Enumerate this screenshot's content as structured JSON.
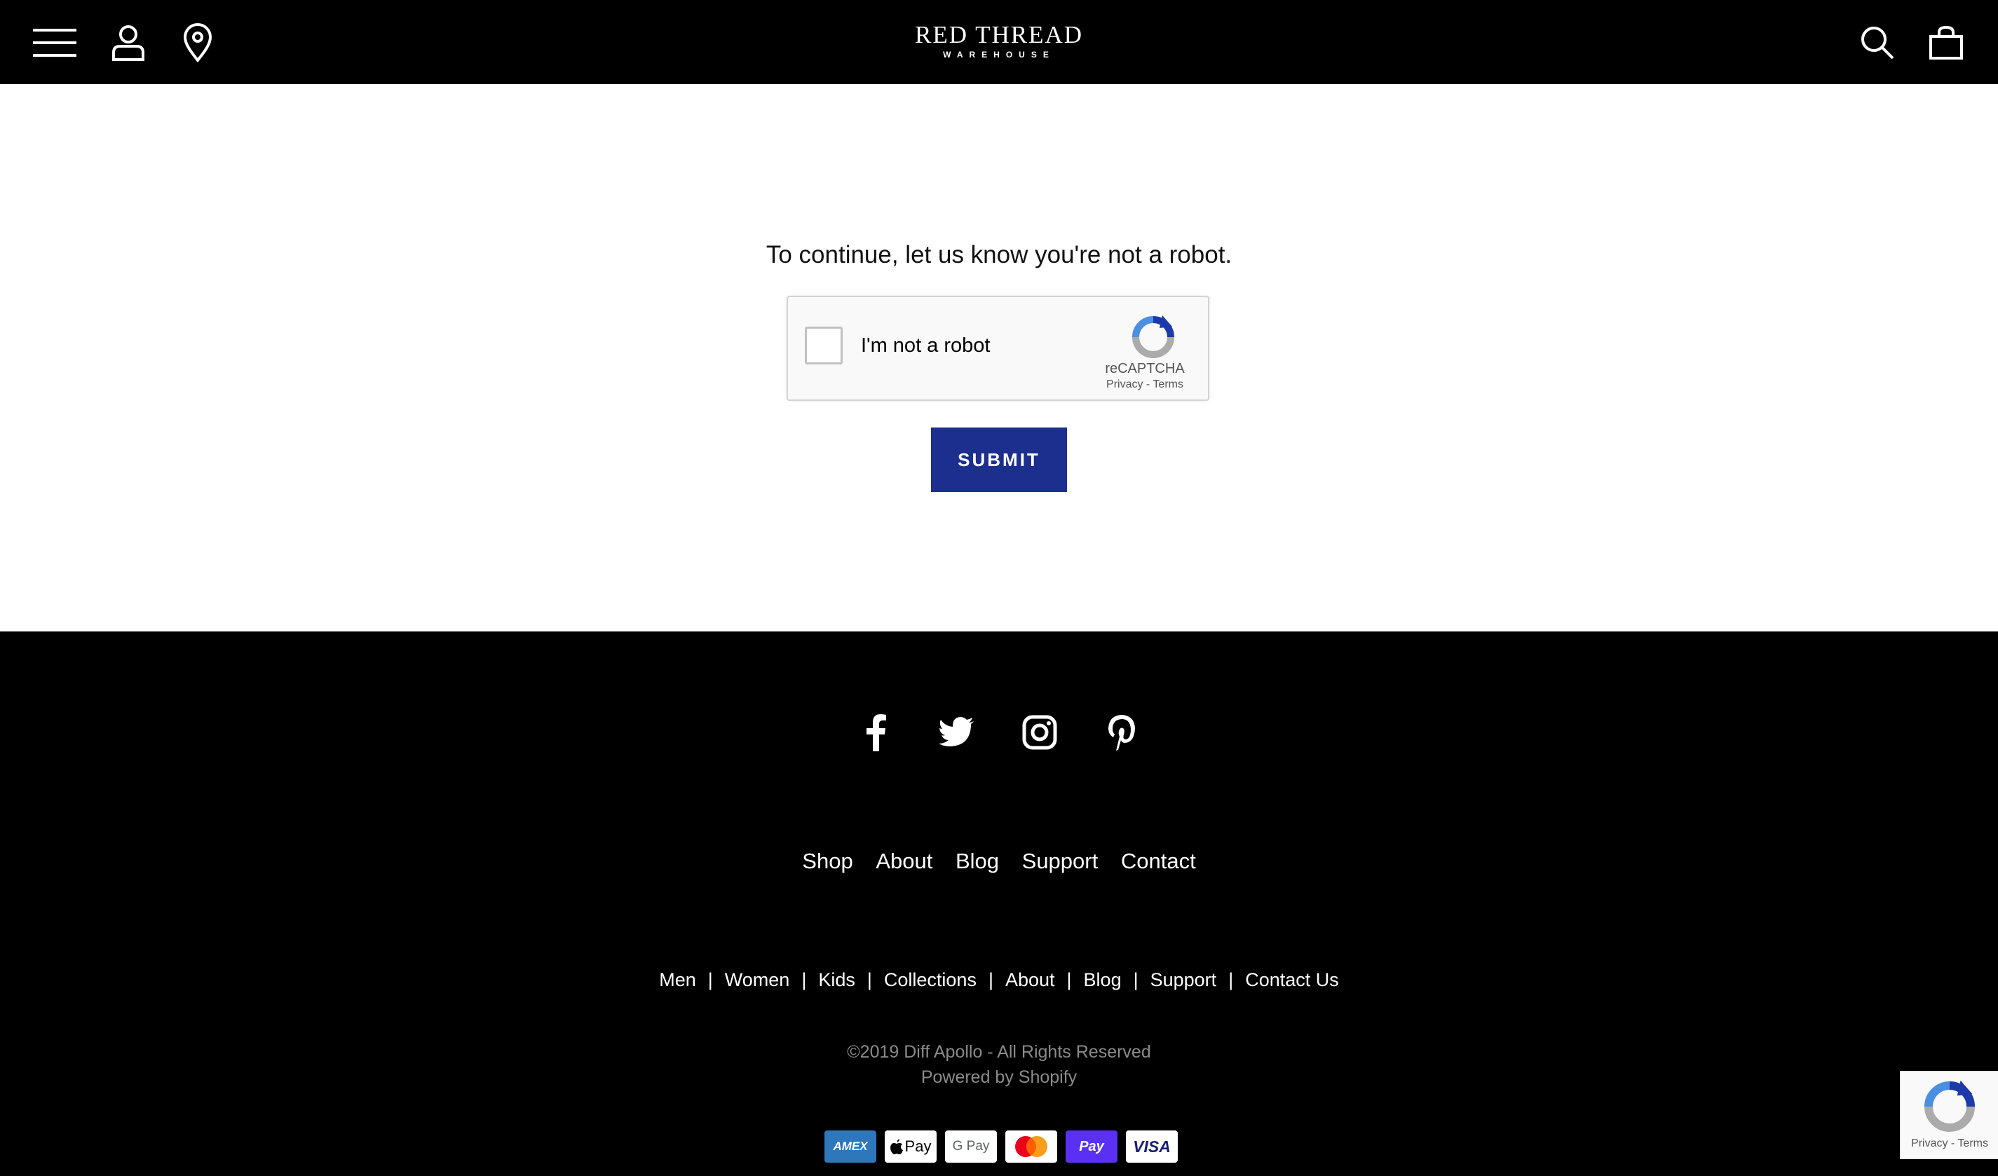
{
  "header": {
    "logo_main": "RED THREAD",
    "logo_sub": "WAREHOUSE",
    "icons": [
      "menu-icon",
      "account-icon",
      "location-pin-icon",
      "search-icon",
      "shopping-bag-icon"
    ]
  },
  "main": {
    "prompt": "To continue, let us know you're not a robot.",
    "captcha": {
      "label": "I'm not a robot",
      "brand": "reCAPTCHA",
      "links": "Privacy - Terms"
    },
    "submit_label": "SUBMIT"
  },
  "footer": {
    "social": [
      "facebook-icon",
      "twitter-icon",
      "instagram-icon",
      "pinterest-icon"
    ],
    "nav_primary": [
      "Shop",
      "About",
      "Blog",
      "Support",
      "Contact"
    ],
    "nav_secondary": [
      "Men",
      "Women",
      "Kids",
      "Collections",
      "About",
      "Blog",
      "Support",
      "Contact Us"
    ],
    "separator": "|",
    "copyright": "©2019 Diff Apollo - All Rights Reserved",
    "powered": "Powered by Shopify",
    "payments": [
      {
        "label": "AMEX",
        "bg": "#2e77bb",
        "fg": "#ffffff"
      },
      {
        "label": "Pay",
        "bg": "#ffffff",
        "fg": "#000000"
      },
      {
        "label": "G Pay",
        "bg": "#ffffff",
        "fg": "#5f6368"
      },
      {
        "label": "",
        "bg": "#ffffff",
        "fg": "#000000"
      },
      {
        "label": "Pay",
        "bg": "#5a31f4",
        "fg": "#ffffff"
      },
      {
        "label": "VISA",
        "bg": "#ffffff",
        "fg": "#1a1f71"
      }
    ],
    "recaptcha_badge_links": "Privacy - Terms"
  },
  "colors": {
    "submit_bg": "#1c2e8e",
    "header_bg": "#000000",
    "footer_bg": "#000000"
  }
}
